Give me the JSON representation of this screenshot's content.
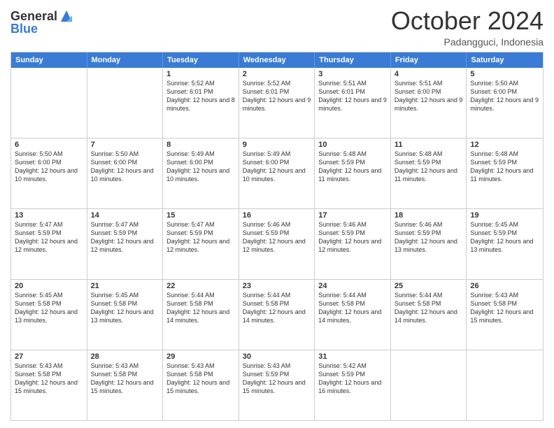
{
  "logo": {
    "line1": "General",
    "line2": "Blue"
  },
  "title": "October 2024",
  "location": "Padangguci, Indonesia",
  "header": {
    "days": [
      "Sunday",
      "Monday",
      "Tuesday",
      "Wednesday",
      "Thursday",
      "Friday",
      "Saturday"
    ]
  },
  "weeks": [
    [
      {
        "day": "",
        "text": ""
      },
      {
        "day": "",
        "text": ""
      },
      {
        "day": "1",
        "text": "Sunrise: 5:52 AM\nSunset: 6:01 PM\nDaylight: 12 hours and 8 minutes."
      },
      {
        "day": "2",
        "text": "Sunrise: 5:52 AM\nSunset: 6:01 PM\nDaylight: 12 hours and 9 minutes."
      },
      {
        "day": "3",
        "text": "Sunrise: 5:51 AM\nSunset: 6:01 PM\nDaylight: 12 hours and 9 minutes."
      },
      {
        "day": "4",
        "text": "Sunrise: 5:51 AM\nSunset: 6:00 PM\nDaylight: 12 hours and 9 minutes."
      },
      {
        "day": "5",
        "text": "Sunrise: 5:50 AM\nSunset: 6:00 PM\nDaylight: 12 hours and 9 minutes."
      }
    ],
    [
      {
        "day": "6",
        "text": "Sunrise: 5:50 AM\nSunset: 6:00 PM\nDaylight: 12 hours and 10 minutes."
      },
      {
        "day": "7",
        "text": "Sunrise: 5:50 AM\nSunset: 6:00 PM\nDaylight: 12 hours and 10 minutes."
      },
      {
        "day": "8",
        "text": "Sunrise: 5:49 AM\nSunset: 6:00 PM\nDaylight: 12 hours and 10 minutes."
      },
      {
        "day": "9",
        "text": "Sunrise: 5:49 AM\nSunset: 6:00 PM\nDaylight: 12 hours and 10 minutes."
      },
      {
        "day": "10",
        "text": "Sunrise: 5:48 AM\nSunset: 5:59 PM\nDaylight: 12 hours and 11 minutes."
      },
      {
        "day": "11",
        "text": "Sunrise: 5:48 AM\nSunset: 5:59 PM\nDaylight: 12 hours and 11 minutes."
      },
      {
        "day": "12",
        "text": "Sunrise: 5:48 AM\nSunset: 5:59 PM\nDaylight: 12 hours and 11 minutes."
      }
    ],
    [
      {
        "day": "13",
        "text": "Sunrise: 5:47 AM\nSunset: 5:59 PM\nDaylight: 12 hours and 12 minutes."
      },
      {
        "day": "14",
        "text": "Sunrise: 5:47 AM\nSunset: 5:59 PM\nDaylight: 12 hours and 12 minutes."
      },
      {
        "day": "15",
        "text": "Sunrise: 5:47 AM\nSunset: 5:59 PM\nDaylight: 12 hours and 12 minutes."
      },
      {
        "day": "16",
        "text": "Sunrise: 5:46 AM\nSunset: 5:59 PM\nDaylight: 12 hours and 12 minutes."
      },
      {
        "day": "17",
        "text": "Sunrise: 5:46 AM\nSunset: 5:59 PM\nDaylight: 12 hours and 12 minutes."
      },
      {
        "day": "18",
        "text": "Sunrise: 5:46 AM\nSunset: 5:59 PM\nDaylight: 12 hours and 13 minutes."
      },
      {
        "day": "19",
        "text": "Sunrise: 5:45 AM\nSunset: 5:59 PM\nDaylight: 12 hours and 13 minutes."
      }
    ],
    [
      {
        "day": "20",
        "text": "Sunrise: 5:45 AM\nSunset: 5:58 PM\nDaylight: 12 hours and 13 minutes."
      },
      {
        "day": "21",
        "text": "Sunrise: 5:45 AM\nSunset: 5:58 PM\nDaylight: 12 hours and 13 minutes."
      },
      {
        "day": "22",
        "text": "Sunrise: 5:44 AM\nSunset: 5:58 PM\nDaylight: 12 hours and 14 minutes."
      },
      {
        "day": "23",
        "text": "Sunrise: 5:44 AM\nSunset: 5:58 PM\nDaylight: 12 hours and 14 minutes."
      },
      {
        "day": "24",
        "text": "Sunrise: 5:44 AM\nSunset: 5:58 PM\nDaylight: 12 hours and 14 minutes."
      },
      {
        "day": "25",
        "text": "Sunrise: 5:44 AM\nSunset: 5:58 PM\nDaylight: 12 hours and 14 minutes."
      },
      {
        "day": "26",
        "text": "Sunrise: 5:43 AM\nSunset: 5:58 PM\nDaylight: 12 hours and 15 minutes."
      }
    ],
    [
      {
        "day": "27",
        "text": "Sunrise: 5:43 AM\nSunset: 5:58 PM\nDaylight: 12 hours and 15 minutes."
      },
      {
        "day": "28",
        "text": "Sunrise: 5:43 AM\nSunset: 5:58 PM\nDaylight: 12 hours and 15 minutes."
      },
      {
        "day": "29",
        "text": "Sunrise: 5:43 AM\nSunset: 5:58 PM\nDaylight: 12 hours and 15 minutes."
      },
      {
        "day": "30",
        "text": "Sunrise: 5:43 AM\nSunset: 5:59 PM\nDaylight: 12 hours and 15 minutes."
      },
      {
        "day": "31",
        "text": "Sunrise: 5:42 AM\nSunset: 5:59 PM\nDaylight: 12 hours and 16 minutes."
      },
      {
        "day": "",
        "text": ""
      },
      {
        "day": "",
        "text": ""
      }
    ]
  ]
}
